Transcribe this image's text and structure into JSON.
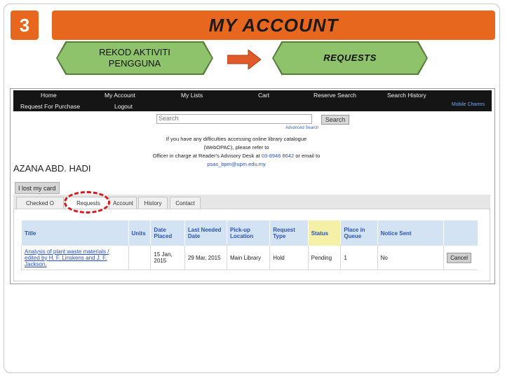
{
  "slide": {
    "number": "3",
    "title": "MY ACCOUNT",
    "step_left_line1": "REKOD AKTIVITI",
    "step_left_line2": "PENGGUNA",
    "step_right": "REQUESTS",
    "accent_color": "#e8671e",
    "step_color": "#8ec26b",
    "arrow_color": "#e05a2a",
    "highlight_color": "#d7191c"
  },
  "nav": {
    "row1": [
      "Home",
      "My Account",
      "My Lists",
      "Cart",
      "Reserve Search",
      "Search History"
    ],
    "row2": [
      "Request For Purchase",
      "Logout"
    ],
    "mobile_link": "Mobile Charms"
  },
  "search": {
    "placeholder": "Search",
    "button": "Search",
    "advanced": "Advanced Search"
  },
  "notice": {
    "line1": "If you have any difficulties accessing online library catalogue (WebOPAC), please refer to",
    "line2_prefix": "Officer in charge at Reader's Advisory Desk at ",
    "phone": "03-8946 8642",
    "line2_middle": " or email to ",
    "email": "psas_bpm@upm.edu.my"
  },
  "user": {
    "name": "AZANA ABD. HADI",
    "lost_card": "I lost my card"
  },
  "tabs": [
    "Checked Out",
    "Requests",
    "Account",
    "History",
    "Contact"
  ],
  "active_tab": "Requests",
  "table": {
    "headers": [
      "Title",
      "Units",
      "Date Placed",
      "Last Needed Date",
      "Pick-up Location",
      "Request Type",
      "Status",
      "Place in Queue",
      "Notice Sent",
      ""
    ],
    "rows": [
      {
        "title": "Analysis of plant waste materials / edited by H. F. Linskens and J. F. Jackson.",
        "units": "",
        "date_placed": "15 Jan, 2015",
        "last_needed": "29 Mar, 2015",
        "pickup": "Main Library",
        "request_type": "Hold",
        "status": "Pending",
        "queue": "1",
        "notice_sent": "No",
        "action": "Cancel"
      }
    ]
  }
}
